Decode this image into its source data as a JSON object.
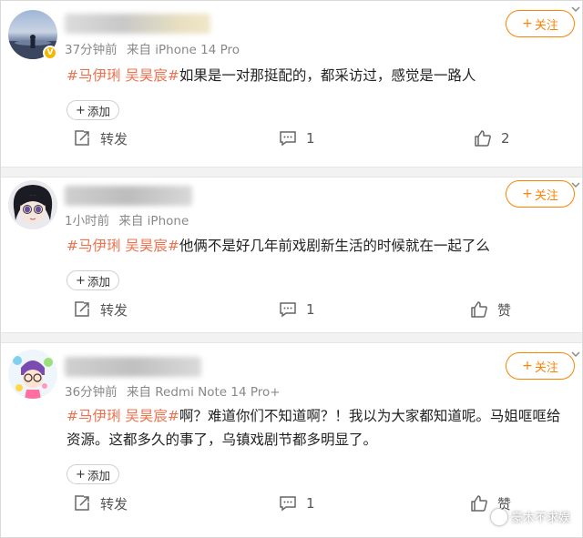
{
  "comments": [
    {
      "meta_time": "37分钟前",
      "meta_source": "来自 iPhone 14 Pro",
      "follow_label": "关注",
      "tag": "#马伊琍 吴昊宸#",
      "text": "如果是一对那挺配的，都采访过，感觉是一路人",
      "add_label": "添加",
      "repost_label": "转发",
      "comment_count": "1",
      "like_label": "2"
    },
    {
      "meta_time": "1小时前",
      "meta_source": "来自 iPhone",
      "follow_label": "关注",
      "tag": "#马伊琍 吴昊宸#",
      "text": "他俩不是好几年前戏剧新生活的时候就在一起了么",
      "add_label": "添加",
      "repost_label": "转发",
      "comment_count": "1",
      "like_label": "赞"
    },
    {
      "meta_time": "36分钟前",
      "meta_source": "来自 Redmi Note 14 Pro+",
      "follow_label": "关注",
      "tag": "#马伊琍 吴昊宸#",
      "text": "啊？难道你们不知道啊？！我以为大家都知道呢。马姐哐哐给资源。这都多久的事了，乌镇戏剧节都多明显了。",
      "add_label": "添加",
      "repost_label": "转发",
      "comment_count": "1",
      "like_label": "赞"
    }
  ],
  "watermark": "豪木不求娱",
  "colors": {
    "accent": "#ff8200",
    "tag": "#eb7350",
    "divider": "#f2f2f2"
  },
  "icons": [
    "repost-icon",
    "comment-icon",
    "thumbs-up-icon",
    "chevron-down-icon",
    "verified-badge-icon"
  ]
}
